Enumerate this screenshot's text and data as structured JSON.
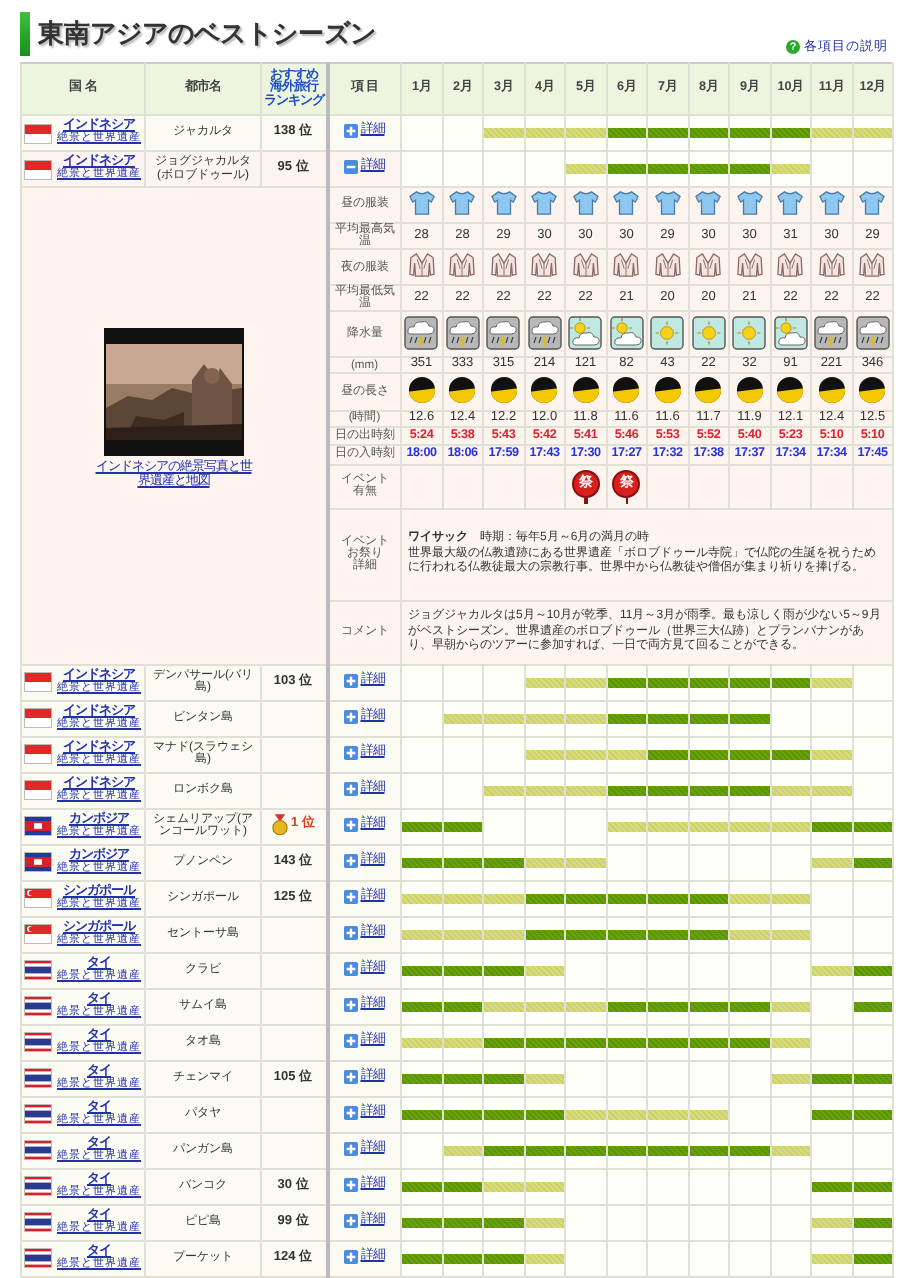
{
  "title": "東南アジアのベストシーズン",
  "help": {
    "glyph": "?",
    "label": "各項目の説明"
  },
  "columns": {
    "country": "国 名",
    "city": "都市名",
    "ranking": [
      "おすすめ",
      "海外旅行",
      "ランキング"
    ],
    "item": "項 目",
    "months": [
      "1月",
      "2月",
      "3月",
      "4月",
      "5月",
      "6月",
      "7月",
      "8月",
      "9月",
      "10月",
      "11月",
      "12月"
    ]
  },
  "rows": [
    {
      "country": "インドネシア",
      "flag": {
        "kind": "indonesia"
      },
      "sublink": "絶景と世界遺産",
      "city": "ジャカルタ",
      "rank": "138 位",
      "medal": false,
      "detail_label": "詳細",
      "expanded": false,
      "months": [
        {
          "kind": "none"
        },
        {
          "kind": "none"
        },
        {
          "kind": "good"
        },
        {
          "kind": "good"
        },
        {
          "kind": "good"
        },
        {
          "kind": "best"
        },
        {
          "kind": "best"
        },
        {
          "kind": "best"
        },
        {
          "kind": "best"
        },
        {
          "kind": "best"
        },
        {
          "kind": "good"
        },
        {
          "kind": "good"
        }
      ]
    },
    {
      "country": "インドネシア",
      "flag": {
        "kind": "indonesia"
      },
      "sublink": "絶景と世界遺産",
      "city": "ジョグジャカルタ(ボロブドゥール)",
      "rank": "95 位",
      "medal": false,
      "detail_label": "詳細",
      "expanded": true,
      "months": [
        {
          "kind": "none"
        },
        {
          "kind": "none"
        },
        {
          "kind": "none"
        },
        {
          "kind": "none"
        },
        {
          "kind": "good"
        },
        {
          "kind": "best"
        },
        {
          "kind": "best"
        },
        {
          "kind": "best"
        },
        {
          "kind": "best"
        },
        {
          "kind": "good"
        },
        {
          "kind": "none"
        },
        {
          "kind": "none"
        }
      ],
      "detail": {
        "photo_caption": "インドネシアの絶景写真と世界遺産と地図",
        "items": [
          {
            "kind": "clothes",
            "label": [
              "昼の服装"
            ],
            "values": [
              {
                "kind": "shirt"
              },
              {
                "kind": "shirt"
              },
              {
                "kind": "shirt"
              },
              {
                "kind": "shirt"
              },
              {
                "kind": "shirt"
              },
              {
                "kind": "shirt"
              },
              {
                "kind": "shirt"
              },
              {
                "kind": "shirt"
              },
              {
                "kind": "shirt"
              },
              {
                "kind": "shirt"
              },
              {
                "kind": "shirt"
              },
              {
                "kind": "shirt"
              }
            ]
          },
          {
            "kind": "numbers",
            "label": [
              "平均最高気温"
            ],
            "values": [
              "28",
              "28",
              "29",
              "30",
              "30",
              "30",
              "29",
              "30",
              "30",
              "31",
              "30",
              "29"
            ]
          },
          {
            "kind": "clothes",
            "label": [
              "夜の服装"
            ],
            "values": [
              {
                "kind": "jacket"
              },
              {
                "kind": "jacket"
              },
              {
                "kind": "jacket"
              },
              {
                "kind": "jacket"
              },
              {
                "kind": "jacket"
              },
              {
                "kind": "jacket"
              },
              {
                "kind": "jacket"
              },
              {
                "kind": "jacket"
              },
              {
                "kind": "jacket"
              },
              {
                "kind": "jacket"
              },
              {
                "kind": "jacket"
              },
              {
                "kind": "jacket"
              }
            ]
          },
          {
            "kind": "numbers",
            "label": [
              "平均最低気温"
            ],
            "values": [
              "22",
              "22",
              "22",
              "22",
              "22",
              "21",
              "20",
              "20",
              "21",
              "22",
              "22",
              "22"
            ]
          },
          {
            "kind": "weather",
            "label": [
              "降水量"
            ],
            "values": [
              {
                "kind": "storm"
              },
              {
                "kind": "storm"
              },
              {
                "kind": "storm"
              },
              {
                "kind": "storm"
              },
              {
                "kind": "partly"
              },
              {
                "kind": "partly"
              },
              {
                "kind": "sunny"
              },
              {
                "kind": "sunny"
              },
              {
                "kind": "sunny"
              },
              {
                "kind": "partly"
              },
              {
                "kind": "storm"
              },
              {
                "kind": "storm"
              }
            ]
          },
          {
            "kind": "numbers",
            "label": [
              "(mm)"
            ],
            "values": [
              "351",
              "333",
              "315",
              "214",
              "121",
              "82",
              "43",
              "22",
              "32",
              "91",
              "221",
              "346"
            ]
          },
          {
            "kind": "daylight",
            "label": [
              "昼の長さ"
            ]
          },
          {
            "kind": "numbers",
            "label": [
              "(時間)"
            ],
            "values": [
              "12.6",
              "12.4",
              "12.2",
              "12.0",
              "11.8",
              "11.6",
              "11.6",
              "11.7",
              "11.9",
              "12.1",
              "12.4",
              "12.5"
            ]
          },
          {
            "kind": "sunrise",
            "label": [
              "日の出時刻"
            ],
            "values": [
              "5:24",
              "5:38",
              "5:43",
              "5:42",
              "5:41",
              "5:46",
              "5:53",
              "5:52",
              "5:40",
              "5:23",
              "5:10",
              "5:10"
            ]
          },
          {
            "kind": "sunset",
            "label": [
              "日の入時刻"
            ],
            "values": [
              "18:00",
              "18:06",
              "17:59",
              "17:43",
              "17:30",
              "17:27",
              "17:32",
              "17:38",
              "17:37",
              "17:34",
              "17:34",
              "17:45"
            ]
          },
          {
            "kind": "events",
            "label": [
              "イベント",
              "有無"
            ],
            "values": [
              {
                "festival": false
              },
              {
                "festival": false
              },
              {
                "festival": false
              },
              {
                "festival": false
              },
              {
                "festival": true,
                "glyph": "祭"
              },
              {
                "festival": true,
                "glyph": "祭"
              },
              {
                "festival": false
              },
              {
                "festival": false
              },
              {
                "festival": false
              },
              {
                "festival": false
              },
              {
                "festival": false
              },
              {
                "festival": false
              }
            ]
          },
          {
            "kind": "note",
            "label": [
              "イベント",
              "お祭り",
              "詳細"
            ],
            "title": "**ワイサック**　時期：毎年5月～6月の満月の時",
            "body": "世界最大級の仏教遺跡にある世界遺産「ボロブドゥール寺院」で仏陀の生誕を祝うために行われる仏教徒最大の宗教行事。世界中から仏教徒や僧侶が集まり祈りを捧げる。"
          },
          {
            "kind": "comment",
            "label": [
              "コメント"
            ],
            "body": "ジョグジャカルタは5月～10月が乾季、11月～3月が雨季。最も涼しく雨が少ない5～9月がベストシーズン。世界遺産のボロブドゥール（世界三大仏跡）とプランバナンがあり、早朝からのツアーに参加すれば、一日で両方見て回ることができる。"
          }
        ]
      }
    },
    {
      "country": "インドネシア",
      "flag": {
        "kind": "indonesia"
      },
      "sublink": "絶景と世界遺産",
      "city": "デンパサール(バリ島)",
      "rank": "103 位",
      "medal": false,
      "detail_label": "詳細",
      "expanded": false,
      "months": [
        {
          "kind": "none"
        },
        {
          "kind": "none"
        },
        {
          "kind": "none"
        },
        {
          "kind": "good"
        },
        {
          "kind": "good"
        },
        {
          "kind": "best"
        },
        {
          "kind": "best"
        },
        {
          "kind": "best"
        },
        {
          "kind": "best"
        },
        {
          "kind": "best"
        },
        {
          "kind": "good"
        },
        {
          "kind": "none"
        }
      ]
    },
    {
      "country": "インドネシア",
      "flag": {
        "kind": "indonesia"
      },
      "sublink": "絶景と世界遺産",
      "city": "ビンタン島",
      "detail_label": "詳細",
      "expanded": false,
      "months": [
        {
          "kind": "none"
        },
        {
          "kind": "good"
        },
        {
          "kind": "good"
        },
        {
          "kind": "good"
        },
        {
          "kind": "good"
        },
        {
          "kind": "best"
        },
        {
          "kind": "best"
        },
        {
          "kind": "best"
        },
        {
          "kind": "best"
        },
        {
          "kind": "none"
        },
        {
          "kind": "none"
        },
        {
          "kind": "none"
        }
      ]
    },
    {
      "country": "インドネシア",
      "flag": {
        "kind": "indonesia"
      },
      "sublink": "絶景と世界遺産",
      "city": "マナド(スラウェシ島)",
      "detail_label": "詳細",
      "expanded": false,
      "months": [
        {
          "kind": "none"
        },
        {
          "kind": "none"
        },
        {
          "kind": "none"
        },
        {
          "kind": "good"
        },
        {
          "kind": "good"
        },
        {
          "kind": "good"
        },
        {
          "kind": "best"
        },
        {
          "kind": "best"
        },
        {
          "kind": "best"
        },
        {
          "kind": "best"
        },
        {
          "kind": "good"
        },
        {
          "kind": "none"
        }
      ]
    },
    {
      "country": "インドネシア",
      "flag": {
        "kind": "indonesia"
      },
      "sublink": "絶景と世界遺産",
      "city": "ロンボク島",
      "detail_label": "詳細",
      "expanded": false,
      "months": [
        {
          "kind": "none"
        },
        {
          "kind": "none"
        },
        {
          "kind": "good"
        },
        {
          "kind": "good"
        },
        {
          "kind": "good"
        },
        {
          "kind": "best"
        },
        {
          "kind": "best"
        },
        {
          "kind": "best"
        },
        {
          "kind": "best"
        },
        {
          "kind": "good"
        },
        {
          "kind": "good"
        },
        {
          "kind": "none"
        }
      ]
    },
    {
      "country": "カンボジア",
      "flag": {
        "kind": "cambodia"
      },
      "sublink": "絶景と世界遺産",
      "city": "シェムリアップ(アンコールワット)",
      "rank": "1 位",
      "medal": true,
      "detail_label": "詳細",
      "expanded": false,
      "months": [
        {
          "kind": "best"
        },
        {
          "kind": "best"
        },
        {
          "kind": "none"
        },
        {
          "kind": "none"
        },
        {
          "kind": "none"
        },
        {
          "kind": "good"
        },
        {
          "kind": "good"
        },
        {
          "kind": "good"
        },
        {
          "kind": "good"
        },
        {
          "kind": "good"
        },
        {
          "kind": "best"
        },
        {
          "kind": "best"
        }
      ]
    },
    {
      "country": "カンボジア",
      "flag": {
        "kind": "cambodia"
      },
      "sublink": "絶景と世界遺産",
      "city": "プノンペン",
      "rank": "143 位",
      "medal": false,
      "detail_label": "詳細",
      "expanded": false,
      "months": [
        {
          "kind": "best"
        },
        {
          "kind": "best"
        },
        {
          "kind": "best"
        },
        {
          "kind": "good"
        },
        {
          "kind": "good"
        },
        {
          "kind": "none"
        },
        {
          "kind": "none"
        },
        {
          "kind": "none"
        },
        {
          "kind": "none"
        },
        {
          "kind": "none"
        },
        {
          "kind": "good"
        },
        {
          "kind": "best"
        }
      ]
    },
    {
      "country": "シンガポール",
      "flag": {
        "kind": "singapore"
      },
      "sublink": "絶景と世界遺産",
      "city": "シンガポール",
      "rank": "125 位",
      "medal": false,
      "detail_label": "詳細",
      "expanded": false,
      "months": [
        {
          "kind": "good"
        },
        {
          "kind": "good"
        },
        {
          "kind": "good"
        },
        {
          "kind": "best"
        },
        {
          "kind": "best"
        },
        {
          "kind": "best"
        },
        {
          "kind": "best"
        },
        {
          "kind": "best"
        },
        {
          "kind": "good"
        },
        {
          "kind": "good"
        },
        {
          "kind": "none"
        },
        {
          "kind": "none"
        }
      ]
    },
    {
      "country": "シンガポール",
      "flag": {
        "kind": "singapore"
      },
      "sublink": "絶景と世界遺産",
      "city": "セントーサ島",
      "detail_label": "詳細",
      "expanded": false,
      "months": [
        {
          "kind": "good"
        },
        {
          "kind": "good"
        },
        {
          "kind": "good"
        },
        {
          "kind": "best"
        },
        {
          "kind": "best"
        },
        {
          "kind": "best"
        },
        {
          "kind": "best"
        },
        {
          "kind": "best"
        },
        {
          "kind": "good"
        },
        {
          "kind": "good"
        },
        {
          "kind": "none"
        },
        {
          "kind": "none"
        }
      ]
    },
    {
      "country": "タイ",
      "flag": {
        "kind": "thailand"
      },
      "sublink": "絶景と世界遺産",
      "city": "クラビ",
      "detail_label": "詳細",
      "expanded": false,
      "months": [
        {
          "kind": "best"
        },
        {
          "kind": "best"
        },
        {
          "kind": "best"
        },
        {
          "kind": "good"
        },
        {
          "kind": "none"
        },
        {
          "kind": "none"
        },
        {
          "kind": "none"
        },
        {
          "kind": "none"
        },
        {
          "kind": "none"
        },
        {
          "kind": "none"
        },
        {
          "kind": "good"
        },
        {
          "kind": "best"
        }
      ]
    },
    {
      "country": "タイ",
      "flag": {
        "kind": "thailand"
      },
      "sublink": "絶景と世界遺産",
      "city": "サムイ島",
      "detail_label": "詳細",
      "expanded": false,
      "months": [
        {
          "kind": "best"
        },
        {
          "kind": "best"
        },
        {
          "kind": "good"
        },
        {
          "kind": "good"
        },
        {
          "kind": "good"
        },
        {
          "kind": "best"
        },
        {
          "kind": "best"
        },
        {
          "kind": "best"
        },
        {
          "kind": "best"
        },
        {
          "kind": "good"
        },
        {
          "kind": "none"
        },
        {
          "kind": "best"
        }
      ]
    },
    {
      "country": "タイ",
      "flag": {
        "kind": "thailand"
      },
      "sublink": "絶景と世界遺産",
      "city": "タオ島",
      "detail_label": "詳細",
      "expanded": false,
      "months": [
        {
          "kind": "good"
        },
        {
          "kind": "good"
        },
        {
          "kind": "best"
        },
        {
          "kind": "best"
        },
        {
          "kind": "best"
        },
        {
          "kind": "best"
        },
        {
          "kind": "best"
        },
        {
          "kind": "best"
        },
        {
          "kind": "best"
        },
        {
          "kind": "good"
        },
        {
          "kind": "none"
        },
        {
          "kind": "none"
        }
      ]
    },
    {
      "country": "タイ",
      "flag": {
        "kind": "thailand"
      },
      "sublink": "絶景と世界遺産",
      "city": "チェンマイ",
      "rank": "105 位",
      "medal": false,
      "detail_label": "詳細",
      "expanded": false,
      "months": [
        {
          "kind": "best"
        },
        {
          "kind": "best"
        },
        {
          "kind": "best"
        },
        {
          "kind": "good"
        },
        {
          "kind": "none"
        },
        {
          "kind": "none"
        },
        {
          "kind": "none"
        },
        {
          "kind": "none"
        },
        {
          "kind": "none"
        },
        {
          "kind": "good"
        },
        {
          "kind": "best"
        },
        {
          "kind": "best"
        }
      ]
    },
    {
      "country": "タイ",
      "flag": {
        "kind": "thailand"
      },
      "sublink": "絶景と世界遺産",
      "city": "パタヤ",
      "detail_label": "詳細",
      "expanded": false,
      "months": [
        {
          "kind": "best"
        },
        {
          "kind": "best"
        },
        {
          "kind": "best"
        },
        {
          "kind": "best"
        },
        {
          "kind": "good"
        },
        {
          "kind": "good"
        },
        {
          "kind": "good"
        },
        {
          "kind": "good"
        },
        {
          "kind": "none"
        },
        {
          "kind": "none"
        },
        {
          "kind": "best"
        },
        {
          "kind": "best"
        }
      ]
    },
    {
      "country": "タイ",
      "flag": {
        "kind": "thailand"
      },
      "sublink": "絶景と世界遺産",
      "city": "パンガン島",
      "detail_label": "詳細",
      "expanded": false,
      "months": [
        {
          "kind": "none"
        },
        {
          "kind": "good"
        },
        {
          "kind": "best"
        },
        {
          "kind": "best"
        },
        {
          "kind": "best"
        },
        {
          "kind": "best"
        },
        {
          "kind": "best"
        },
        {
          "kind": "best"
        },
        {
          "kind": "best"
        },
        {
          "kind": "good"
        },
        {
          "kind": "none"
        },
        {
          "kind": "none"
        }
      ]
    },
    {
      "country": "タイ",
      "flag": {
        "kind": "thailand"
      },
      "sublink": "絶景と世界遺産",
      "city": "バンコク",
      "rank": "30 位",
      "medal": false,
      "detail_label": "詳細",
      "expanded": false,
      "months": [
        {
          "kind": "best"
        },
        {
          "kind": "best"
        },
        {
          "kind": "good"
        },
        {
          "kind": "good"
        },
        {
          "kind": "none"
        },
        {
          "kind": "none"
        },
        {
          "kind": "none"
        },
        {
          "kind": "none"
        },
        {
          "kind": "none"
        },
        {
          "kind": "none"
        },
        {
          "kind": "best"
        },
        {
          "kind": "best"
        }
      ]
    },
    {
      "country": "タイ",
      "flag": {
        "kind": "thailand"
      },
      "sublink": "絶景と世界遺産",
      "city": "ピピ島",
      "rank": "99 位",
      "medal": false,
      "detail_label": "詳細",
      "expanded": false,
      "months": [
        {
          "kind": "best"
        },
        {
          "kind": "best"
        },
        {
          "kind": "best"
        },
        {
          "kind": "good"
        },
        {
          "kind": "none"
        },
        {
          "kind": "none"
        },
        {
          "kind": "none"
        },
        {
          "kind": "none"
        },
        {
          "kind": "none"
        },
        {
          "kind": "none"
        },
        {
          "kind": "good"
        },
        {
          "kind": "best"
        }
      ]
    },
    {
      "country": "タイ",
      "flag": {
        "kind": "thailand"
      },
      "sublink": "絶景と世界遺産",
      "city": "プーケット",
      "rank": "124 位",
      "medal": false,
      "detail_label": "詳細",
      "expanded": false,
      "months": [
        {
          "kind": "best"
        },
        {
          "kind": "best"
        },
        {
          "kind": "best"
        },
        {
          "kind": "good"
        },
        {
          "kind": "none"
        },
        {
          "kind": "none"
        },
        {
          "kind": "none"
        },
        {
          "kind": "none"
        },
        {
          "kind": "none"
        },
        {
          "kind": "none"
        },
        {
          "kind": "good"
        },
        {
          "kind": "best"
        }
      ]
    }
  ]
}
